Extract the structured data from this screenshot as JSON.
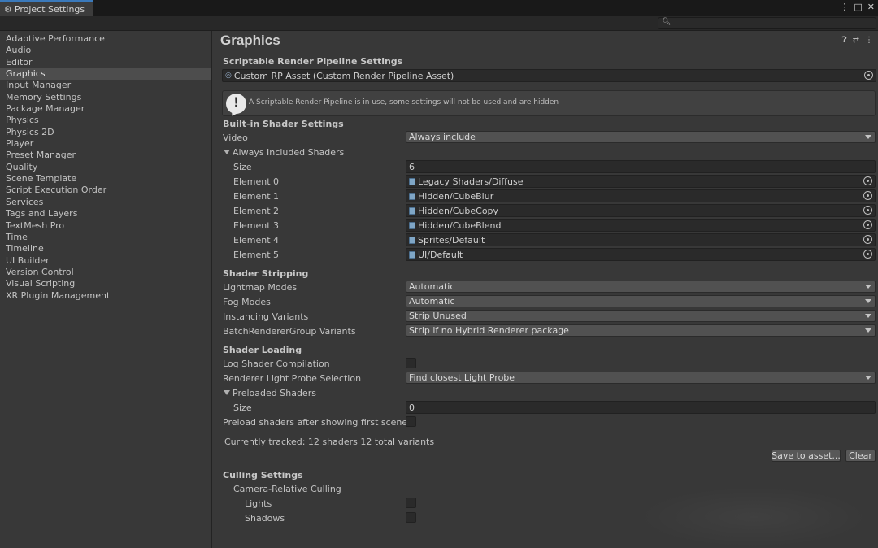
{
  "window": {
    "tab_title": "Project Settings",
    "controls": [
      "⋮",
      "□",
      "✕"
    ]
  },
  "search": {
    "placeholder": ""
  },
  "sidebar": {
    "items": [
      "Adaptive Performance",
      "Audio",
      "Editor",
      "Graphics",
      "Input Manager",
      "Memory Settings",
      "Package Manager",
      "Physics",
      "Physics 2D",
      "Player",
      "Preset Manager",
      "Quality",
      "Scene Template",
      "Script Execution Order",
      "Services",
      "Tags and Layers",
      "TextMesh Pro",
      "Time",
      "Timeline",
      "UI Builder",
      "Version Control",
      "Visual Scripting",
      "XR Plugin Management"
    ],
    "selected": "Graphics"
  },
  "main": {
    "title": "Graphics",
    "header_icons": [
      "help-icon",
      "preset-icon",
      "more-icon"
    ],
    "srp": {
      "heading": "Scriptable Render Pipeline Settings",
      "asset_value": "Custom RP Asset (Custom Render Pipeline Asset)",
      "help_message": "A Scriptable Render Pipeline is in use, some settings will not be used and are hidden",
      "help_glyph": "!"
    },
    "builtin": {
      "heading": "Built-in Shader Settings",
      "video_label": "Video",
      "video_value": "Always include",
      "always_included_label": "Always Included Shaders",
      "size_label": "Size",
      "size_value": "6",
      "elements": [
        {
          "label": "Element 0",
          "value": "Legacy Shaders/Diffuse"
        },
        {
          "label": "Element 1",
          "value": "Hidden/CubeBlur"
        },
        {
          "label": "Element 2",
          "value": "Hidden/CubeCopy"
        },
        {
          "label": "Element 3",
          "value": "Hidden/CubeBlend"
        },
        {
          "label": "Element 4",
          "value": "Sprites/Default"
        },
        {
          "label": "Element 5",
          "value": "UI/Default"
        }
      ]
    },
    "stripping": {
      "heading": "Shader Stripping",
      "rows": [
        {
          "label": "Lightmap Modes",
          "value": "Automatic"
        },
        {
          "label": "Fog Modes",
          "value": "Automatic"
        },
        {
          "label": "Instancing Variants",
          "value": "Strip Unused"
        },
        {
          "label": "BatchRendererGroup Variants",
          "value": "Strip if no Hybrid Renderer package"
        }
      ]
    },
    "loading": {
      "heading": "Shader Loading",
      "log_label": "Log Shader Compilation",
      "probe_label": "Renderer Light Probe Selection",
      "probe_value": "Find closest Light Probe",
      "preloaded_label": "Preloaded Shaders",
      "size_label": "Size",
      "size_value": "0",
      "preload_after_label": "Preload shaders after showing first scene",
      "tracked_text": "Currently tracked: 12 shaders 12 total variants",
      "save_button": "Save to asset...",
      "clear_button": "Clear"
    },
    "culling": {
      "heading": "Culling Settings",
      "camera_relative_label": "Camera-Relative Culling",
      "lights_label": "Lights",
      "shadows_label": "Shadows"
    }
  }
}
